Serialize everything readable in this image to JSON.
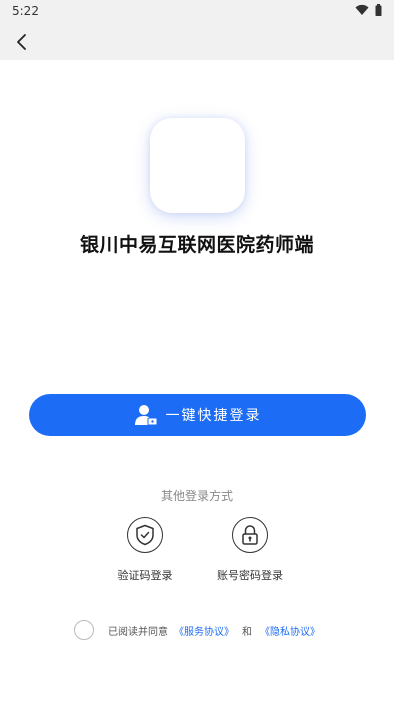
{
  "status_bar": {
    "time": "5:22"
  },
  "app": {
    "title": "银川中易互联网医院药师端"
  },
  "login": {
    "quick_label": "一键快捷登录"
  },
  "other_methods": {
    "label": "其他登录方式",
    "items": [
      {
        "label": "验证码登录",
        "icon": "shield-check-icon"
      },
      {
        "label": "账号密码登录",
        "icon": "lock-icon"
      }
    ]
  },
  "agreement": {
    "prefix": "已阅读并同意",
    "service_link": "《服务协议》",
    "and": "和",
    "privacy_link": "《隐私协议》"
  },
  "colors": {
    "accent": "#1d6cf5",
    "status_bg": "#f1f1f1"
  }
}
